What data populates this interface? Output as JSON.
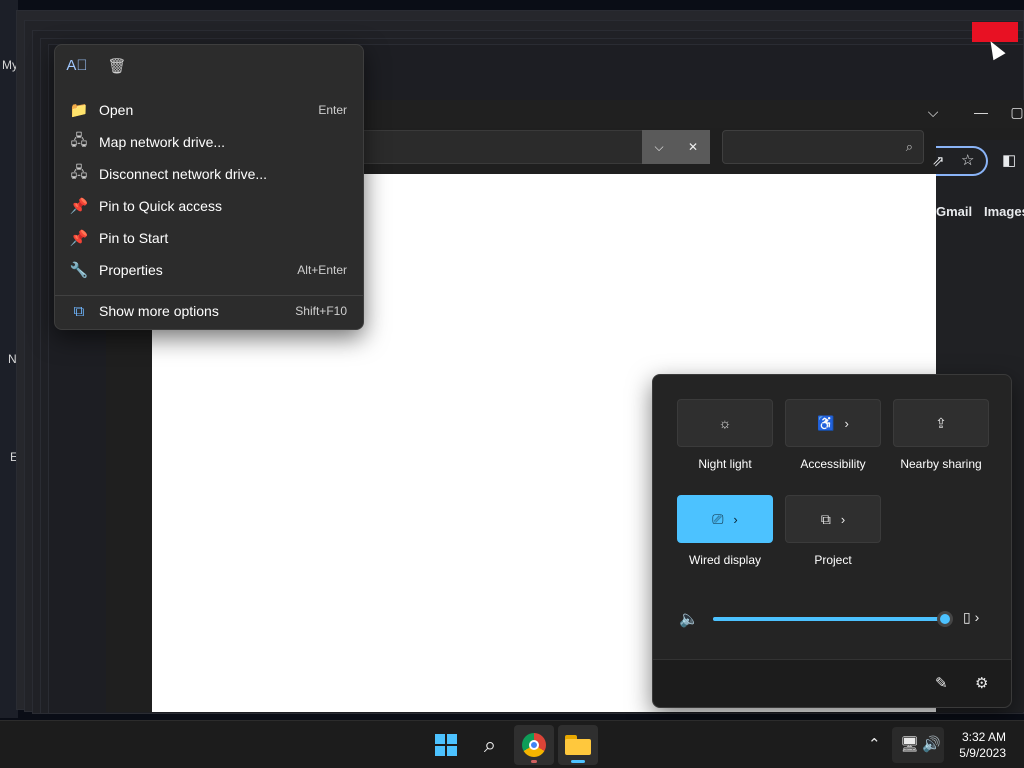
{
  "desktop": {
    "labels": [
      "My",
      "N",
      "E"
    ]
  },
  "explorer": {
    "controls": {
      "chevron": "⌵",
      "minimize": "—",
      "maximize": "▢"
    },
    "address": {
      "dropdown": "⌵",
      "clear": "✕"
    },
    "search": {
      "icon": "⌕",
      "placeholder": ""
    }
  },
  "chrome": {
    "links": {
      "gmail": "Gmail",
      "images": "Images"
    },
    "icons": {
      "share": "⇗",
      "star": "☆",
      "sidebar": "◧"
    }
  },
  "context_menu": {
    "top_actions": [
      {
        "name": "rename-icon",
        "glyph": "A⃞"
      },
      {
        "name": "delete-icon",
        "glyph": "🗑"
      }
    ],
    "items": [
      {
        "label": "Open",
        "shortcut": "Enter",
        "icon": "folder-icon",
        "glyph": "📁"
      },
      {
        "label": "Map network drive...",
        "shortcut": "",
        "icon": "network-drive-icon",
        "glyph": "🖧"
      },
      {
        "label": "Disconnect network drive...",
        "shortcut": "",
        "icon": "disconnect-drive-icon",
        "glyph": "🖧"
      },
      {
        "label": "Pin to Quick access",
        "shortcut": "",
        "icon": "pin-icon",
        "glyph": "📌"
      },
      {
        "label": "Pin to Start",
        "shortcut": "",
        "icon": "pin-icon",
        "glyph": "📌"
      },
      {
        "label": "Properties",
        "shortcut": "Alt+Enter",
        "icon": "wrench-icon",
        "glyph": "🔧"
      },
      {
        "label": "Show more options",
        "shortcut": "Shift+F10",
        "icon": "more-options-icon",
        "glyph": "⧉"
      }
    ]
  },
  "quick_settings": {
    "tiles": [
      {
        "label": "Night light",
        "icon": "night-light-icon",
        "glyph": "☼",
        "chevron": false,
        "active": false
      },
      {
        "label": "Accessibility",
        "icon": "accessibility-icon",
        "glyph": "♿",
        "chevron": true,
        "active": false
      },
      {
        "label": "Nearby sharing",
        "icon": "share-icon",
        "glyph": "⇪",
        "chevron": false,
        "active": false
      },
      {
        "label": "Wired display",
        "icon": "cast-icon",
        "glyph": "⎚",
        "chevron": true,
        "active": true
      },
      {
        "label": "Project",
        "icon": "project-icon",
        "glyph": "⧉",
        "chevron": true,
        "active": false
      }
    ],
    "chevron_glyph": "›",
    "volume": {
      "icon_glyph": "🔈",
      "level": 1.0,
      "output_glyph": "▯ ›"
    },
    "footer": {
      "edit_glyph": "✎",
      "settings_glyph": "⚙"
    },
    "accent_color": "#4cc2ff"
  },
  "taskbar": {
    "search_glyph": "⌕",
    "tray": {
      "chevron_glyph": "⌃",
      "network_glyph": "🖥",
      "volume_glyph": "🔊"
    },
    "clock": {
      "time": "3:32 AM",
      "date": "5/9/2023"
    }
  }
}
